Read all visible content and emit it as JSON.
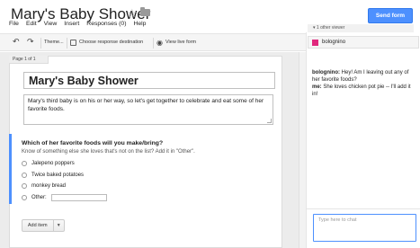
{
  "doc": {
    "title": "Mary's Baby Shower"
  },
  "header": {
    "send_label": "Send form"
  },
  "menu": [
    "File",
    "Edit",
    "View",
    "Insert",
    "Responses (0)",
    "Help"
  ],
  "toolbar": {
    "theme_label": "Theme...",
    "destination_label": "Choose response destination",
    "live_label": "View live form"
  },
  "viewers": {
    "label": "1 other viewer"
  },
  "form": {
    "page_label": "Page 1 of 1",
    "title": "Mary's Baby Shower",
    "description": "Mary's third baby is on his or her way, so let's get together to celebrate and eat some of her favorite foods.",
    "question": {
      "title": "Which of her favorite foods will you make/bring?",
      "help": "Know of something else she loves that's not on the list? Add it in \"Other\".",
      "options": [
        "Jalepeno poppers",
        "Twice baked potatoes",
        "monkey bread"
      ],
      "other_label": "Other:"
    },
    "add_item_label": "Add item"
  },
  "collaborator": {
    "name": "bolognino",
    "color": "#e0287d"
  },
  "chat": {
    "messages": [
      {
        "sender": "bolognino:",
        "text": "Hey! Am I leaving out any of her favorite foods?"
      },
      {
        "sender": "me:",
        "text": "She loves chicken pot pie -- I'll add it in!"
      }
    ],
    "input_placeholder": "Type here to chat"
  },
  "colors": {
    "accent": "#4d90fe",
    "question_bar": "#4d90fe"
  }
}
